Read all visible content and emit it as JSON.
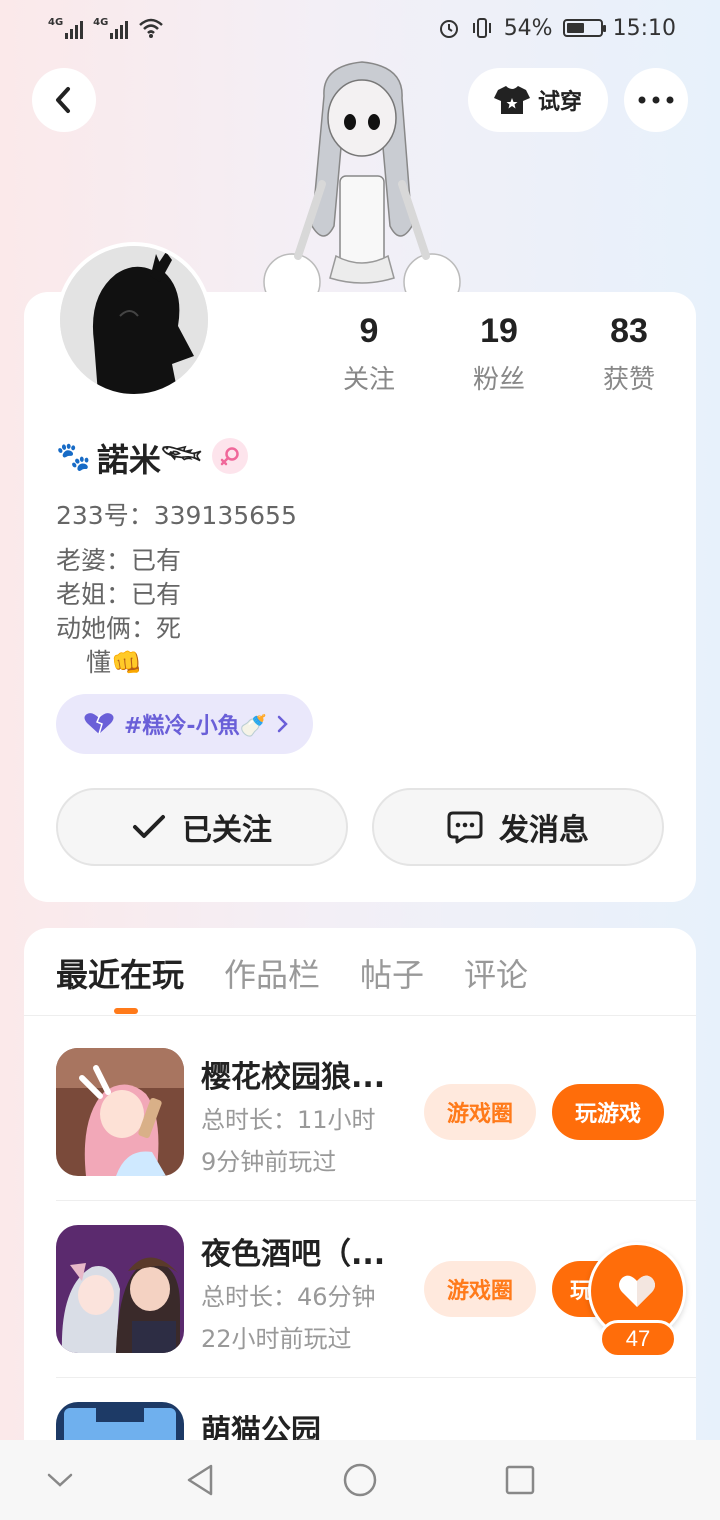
{
  "status_bar": {
    "signal_1": "4G",
    "signal_2": "4G",
    "battery_text": "54%",
    "battery_level": 0.54,
    "time": "15:10"
  },
  "header": {
    "back_icon": "chevron-left-icon",
    "tryon_label": "试穿",
    "more_icon": "more-dots-icon"
  },
  "profile": {
    "stats": [
      {
        "value": "9",
        "label": "关注"
      },
      {
        "value": "19",
        "label": "粉丝"
      },
      {
        "value": "83",
        "label": "获赞"
      }
    ],
    "name_prefix_emoji": "🐾",
    "nickname": "諾米𓆝",
    "gender_icon": "female-icon",
    "uid": "233号：339135655",
    "bio": [
      "老婆：已有",
      "老姐：已有",
      "动她俩：死",
      "懂👊"
    ],
    "circle_tag": "#糕冷-小魚🍼",
    "follow_button": "已关注",
    "message_button": "发消息"
  },
  "tabs": [
    {
      "label": "最近在玩",
      "active": true
    },
    {
      "label": "作品栏",
      "active": false
    },
    {
      "label": "帖子",
      "active": false
    },
    {
      "label": "评论",
      "active": false
    }
  ],
  "games": [
    {
      "title": "樱花校园狼...",
      "duration": "总时长：11小时",
      "last_played": "9分钟前玩过",
      "circle_label": "游戏圈",
      "play_label": "玩游戏"
    },
    {
      "title": "夜色酒吧（...",
      "duration": "总时长：46分钟",
      "last_played": "22小时前玩过",
      "circle_label": "游戏圈",
      "play_label": "玩"
    },
    {
      "title": "萌猫公园"
    }
  ],
  "like": {
    "count": "47",
    "icon": "heart-icon"
  },
  "colors": {
    "accent": "#ff6d0a",
    "accent_light": "#ffe9dd",
    "tag_bg": "#eae8fb",
    "tag_text": "#6a5fd8"
  }
}
